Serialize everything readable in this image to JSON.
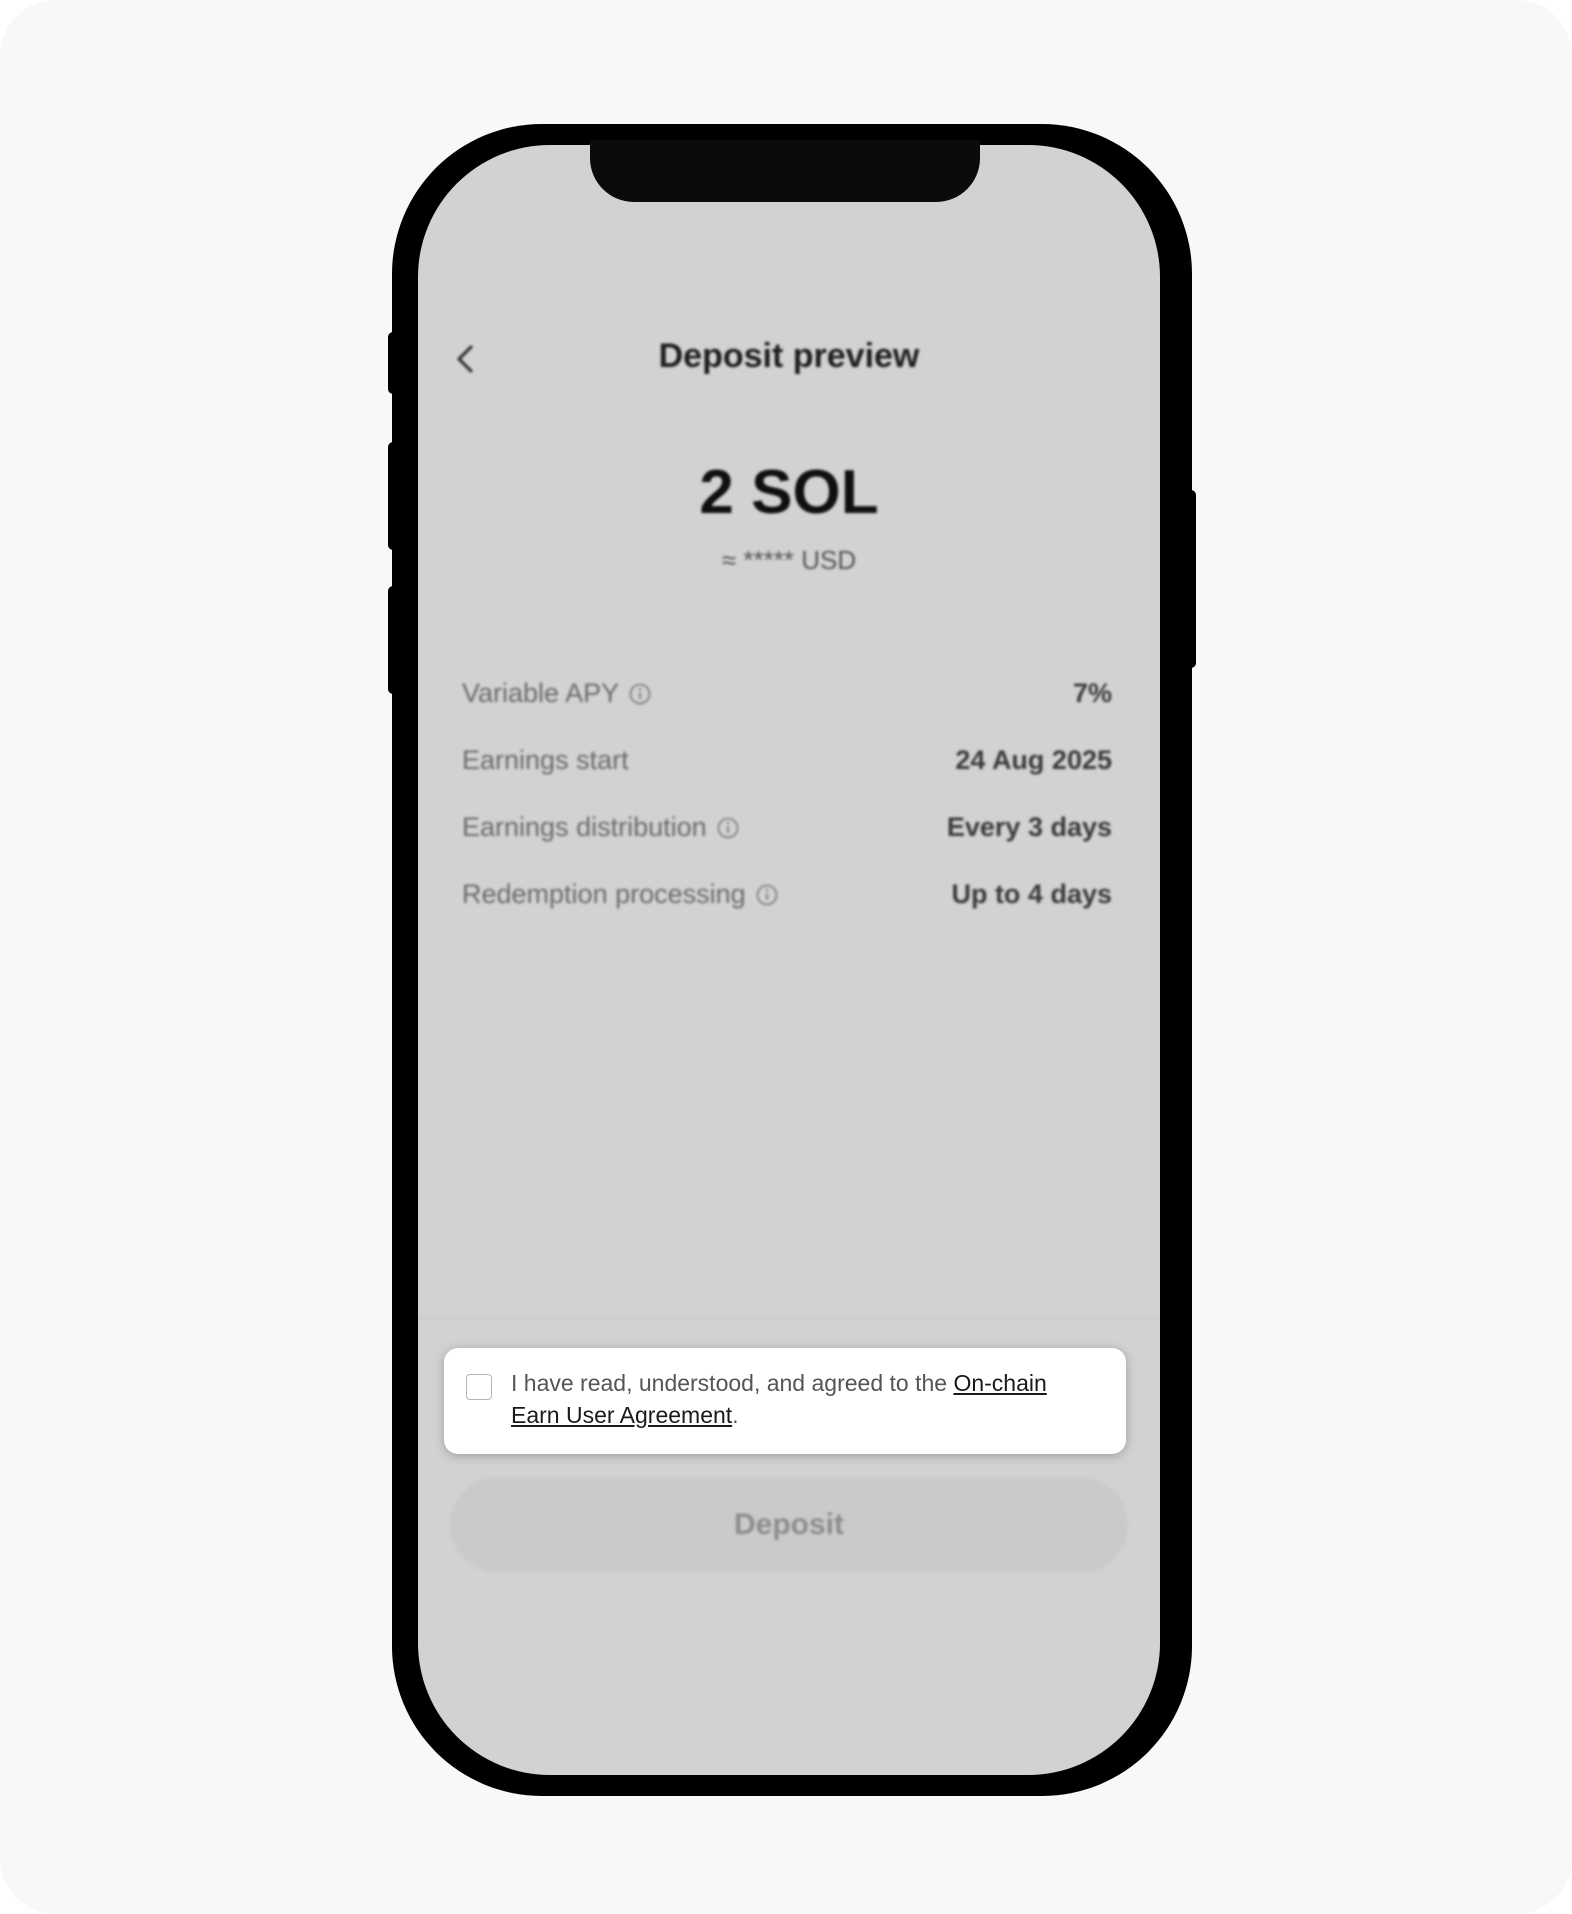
{
  "header": {
    "title": "Deposit preview"
  },
  "summary": {
    "amount": "2 SOL",
    "fiat_equivalent": "≈ ***** USD"
  },
  "details": [
    {
      "label": "Variable APY",
      "value": "7%",
      "info_icon": true
    },
    {
      "label": "Earnings start",
      "value": "24 Aug 2025",
      "info_icon": false
    },
    {
      "label": "Earnings distribution",
      "value": "Every 3 days",
      "info_icon": true
    },
    {
      "label": "Redemption processing",
      "value": "Up to 4 days",
      "info_icon": true
    }
  ],
  "agreement": {
    "text_before": "I have read, understood, and agreed to the ",
    "link_text": "On-chain Earn User Agreement",
    "text_after": ".",
    "checked": false
  },
  "footer": {
    "deposit_label": "Deposit"
  },
  "icons": {
    "back": "chevron-left-icon",
    "info": "info-circle-icon",
    "checkbox": "checkbox-icon"
  },
  "colors": {
    "screen_overlay": "#d2d2d2",
    "text_primary": "#0f0f0f",
    "button_disabled": "#cacaca"
  }
}
